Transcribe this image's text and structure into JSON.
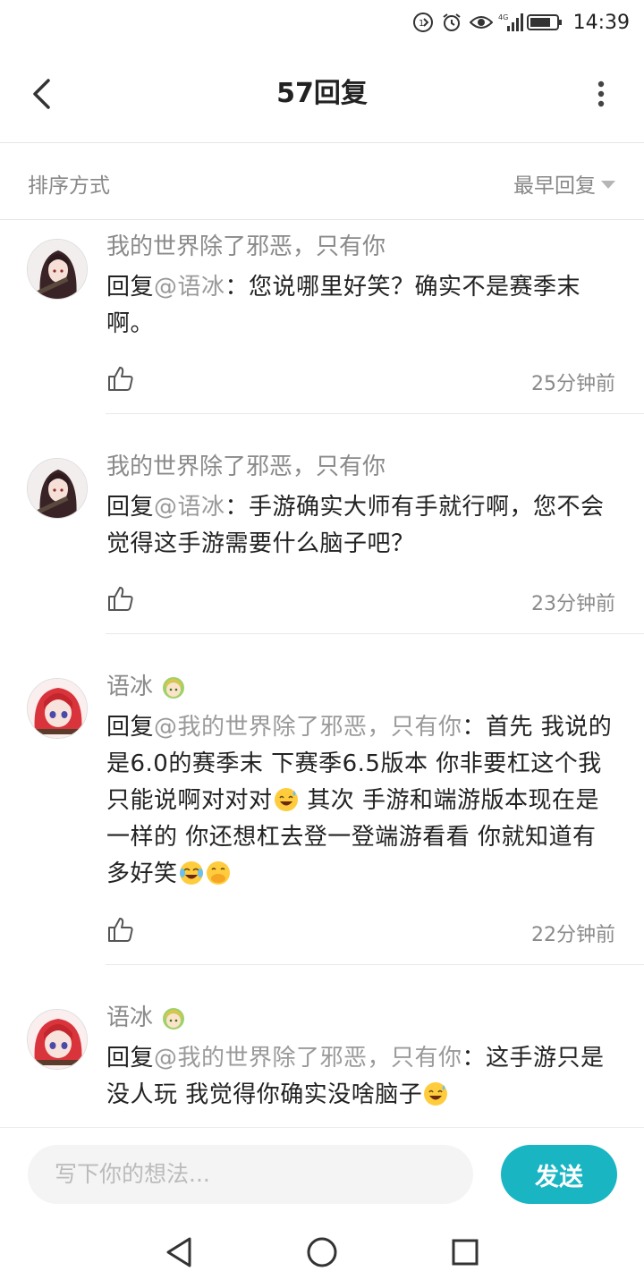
{
  "status_bar": {
    "time": "14:39",
    "network": "4G",
    "icons": [
      "hd-call-icon",
      "alarm-icon",
      "eye-icon",
      "signal-icon",
      "battery-icon"
    ]
  },
  "header": {
    "title": "57回复",
    "back_icon": "chevron-left-icon",
    "more_icon": "vertical-dots-icon"
  },
  "sort": {
    "label": "排序方式",
    "value": "最早回复"
  },
  "comments": [
    {
      "author": "我的世界除了邪恶，只有你",
      "reply_prefix": "回复",
      "mention": "@语冰",
      "text": "：您说哪里好笑？确实不是赛季末啊。",
      "time": "25分钟前",
      "avatar": "dark-hair-girl-avatar"
    },
    {
      "author": "我的世界除了邪恶，只有你",
      "reply_prefix": "回复",
      "mention": "@语冰",
      "text": "：手游确实大师有手就行啊，您不会觉得这手游需要什么脑子吧？",
      "time": "23分钟前",
      "avatar": "dark-hair-girl-avatar"
    },
    {
      "author": "语冰",
      "badge": "green-hair-girl-badge",
      "reply_prefix": "回复",
      "mention": "@我的世界除了邪恶，只有你",
      "text_parts": [
        "：首先 我说的是6.0的赛季末 下赛季6.5版本 你非要杠这个我只能说啊对对对",
        " 其次 手游和端游版本现在是一样的 你还想杠去登一登端游看看 你就知道有多好笑"
      ],
      "emojis": [
        "sweat-smile-emoji",
        "tears-of-joy-emoji",
        "hand-over-mouth-emoji"
      ],
      "time": "22分钟前",
      "avatar": "red-hair-girl-avatar"
    },
    {
      "author": "语冰",
      "badge": "green-hair-girl-badge",
      "reply_prefix": "回复",
      "mention": "@我的世界除了邪恶，只有你",
      "text": "：这手游只是没人玩 我觉得你确实没啥脑子",
      "emojis": [
        "sweat-smile-emoji"
      ],
      "avatar": "red-hair-girl-avatar"
    }
  ],
  "composer": {
    "placeholder": "写下你的想法...",
    "send_label": "发送"
  },
  "colors": {
    "accent": "#19b5c3",
    "muted_text": "#8a8a8a",
    "divider": "#e8e8e8"
  }
}
